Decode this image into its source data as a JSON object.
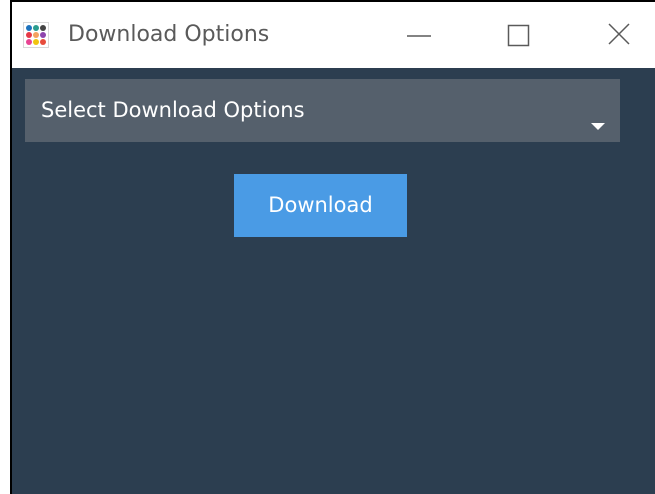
{
  "window": {
    "title": "Download Options"
  },
  "titlebar": {
    "icons": {
      "app": "app-logo-icon",
      "minimize": "minimize-icon",
      "maximize": "maximize-icon",
      "close": "close-icon"
    }
  },
  "dropdown": {
    "selected_label": "Select Download Options",
    "arrow_icon": "caret-down-icon"
  },
  "download_button": {
    "label": "Download"
  },
  "colors": {
    "background": "#2c3e50",
    "dropdown_bg": "#55606c",
    "button_bg": "#4a9be5",
    "text": "#ffffff"
  }
}
